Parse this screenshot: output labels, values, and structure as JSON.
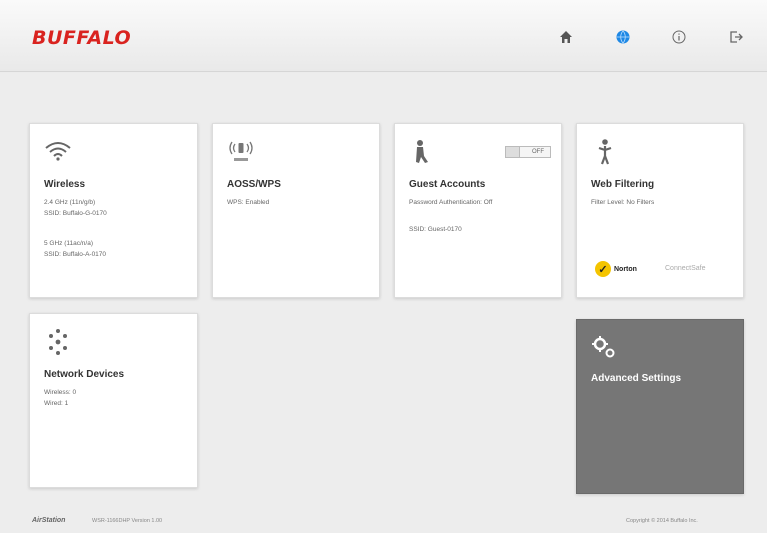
{
  "header": {
    "logo": "BUFFALO",
    "nav": [
      "home-icon",
      "language-icon",
      "info-icon",
      "logout-icon"
    ],
    "accent_color": "#1e88e5"
  },
  "cards": {
    "wireless": {
      "title": "Wireless",
      "lines": [
        "2.4 GHz (11n/g/b)",
        "SSID: Buffalo-G-0170",
        "5 GHz (11ac/n/a)",
        "SSID: Buffalo-A-0170"
      ]
    },
    "aoss": {
      "title": "AOSS/WPS",
      "lines": [
        "WPS: Enabled"
      ]
    },
    "guest": {
      "title": "Guest Accounts",
      "toggle": "OFF",
      "lines": [
        "Password Authentication: Off",
        "SSID: Guest-0170"
      ]
    },
    "web_filtering": {
      "title": "Web Filtering",
      "lines": [
        "Filter Level: No Filters"
      ],
      "norton": "Norton",
      "connectsafe": "ConnectSafe"
    },
    "network_devices": {
      "title": "Network Devices",
      "lines": [
        "Wireless: 0",
        "Wired: 1"
      ]
    },
    "advanced": {
      "title": "Advanced Settings"
    }
  },
  "footer": {
    "brand": "AirStation",
    "model": "WSR-1166DHP Version 1.00",
    "copyright": "Copyright © 2014 Buffalo Inc."
  }
}
